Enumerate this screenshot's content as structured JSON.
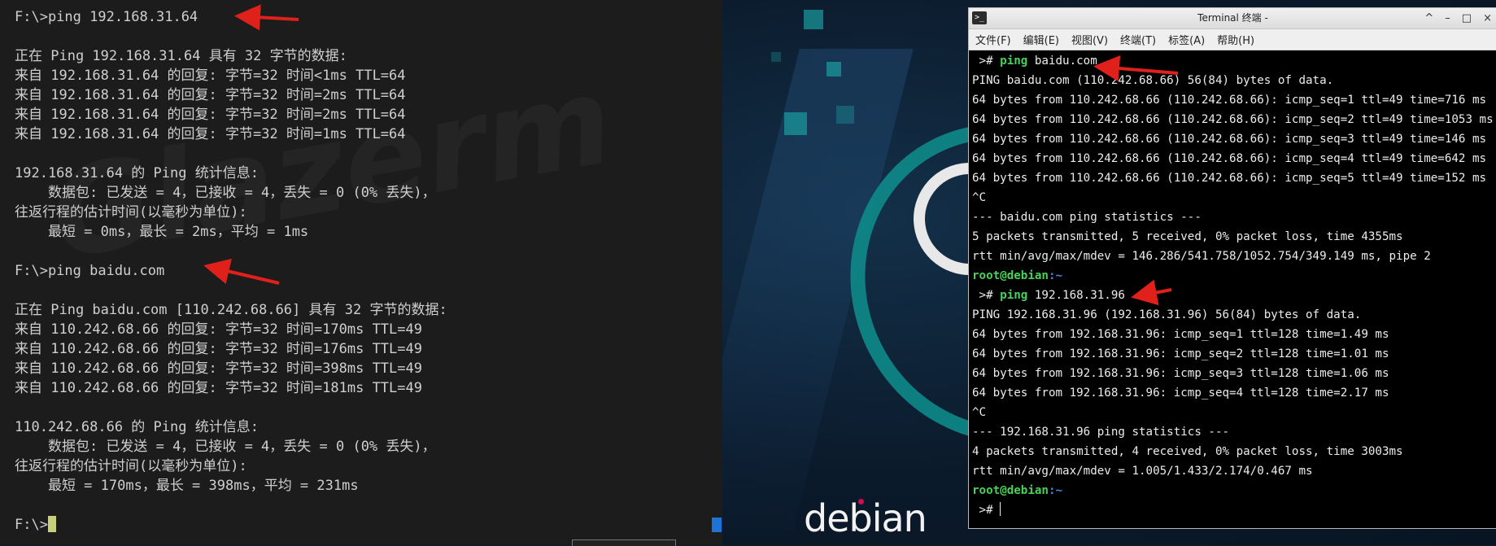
{
  "left_terminal": {
    "lines": [
      "F:\\>ping 192.168.31.64",
      "",
      "正在 Ping 192.168.31.64 具有 32 字节的数据:",
      "来自 192.168.31.64 的回复: 字节=32 时间<1ms TTL=64",
      "来自 192.168.31.64 的回复: 字节=32 时间=2ms TTL=64",
      "来自 192.168.31.64 的回复: 字节=32 时间=2ms TTL=64",
      "来自 192.168.31.64 的回复: 字节=32 时间=1ms TTL=64",
      "",
      "192.168.31.64 的 Ping 统计信息:",
      "    数据包: 已发送 = 4，已接收 = 4，丢失 = 0 (0% 丢失)，",
      "往返行程的估计时间(以毫秒为单位):",
      "    最短 = 0ms，最长 = 2ms，平均 = 1ms",
      "",
      "F:\\>ping baidu.com",
      "",
      "正在 Ping baidu.com [110.242.68.66] 具有 32 字节的数据:",
      "来自 110.242.68.66 的回复: 字节=32 时间=170ms TTL=49",
      "来自 110.242.68.66 的回复: 字节=32 时间=176ms TTL=49",
      "来自 110.242.68.66 的回复: 字节=32 时间=398ms TTL=49",
      "来自 110.242.68.66 的回复: 字节=32 时间=181ms TTL=49",
      "",
      "110.242.68.66 的 Ping 统计信息:",
      "    数据包: 已发送 = 4，已接收 = 4，丢失 = 0 (0% 丢失)，",
      "往返行程的估计时间(以毫秒为单位):",
      "    最短 = 170ms，最长 = 398ms，平均 = 231ms",
      "",
      "F:\\>"
    ]
  },
  "desktop": {
    "logo_text": "debian"
  },
  "xterm": {
    "title": "Terminal 终端 -",
    "window_buttons": [
      "^",
      "–",
      "□",
      "×"
    ],
    "menu": [
      "文件(F)",
      "编辑(E)",
      "视图(V)",
      "终端(T)",
      "标签(A)",
      "帮助(H)"
    ],
    "prompt_user": "root@debian",
    "prompt_path": ":~",
    "prompt_symbol": " >#",
    "cmd1": "ping",
    "cmd1_arg": "baidu.com",
    "block1": [
      "PING baidu.com (110.242.68.66) 56(84) bytes of data.",
      "64 bytes from 110.242.68.66 (110.242.68.66): icmp_seq=1 ttl=49 time=716 ms",
      "64 bytes from 110.242.68.66 (110.242.68.66): icmp_seq=2 ttl=49 time=1053 ms",
      "64 bytes from 110.242.68.66 (110.242.68.66): icmp_seq=3 ttl=49 time=146 ms",
      "64 bytes from 110.242.68.66 (110.242.68.66): icmp_seq=4 ttl=49 time=642 ms",
      "64 bytes from 110.242.68.66 (110.242.68.66): icmp_seq=5 ttl=49 time=152 ms",
      "^C",
      "--- baidu.com ping statistics ---",
      "5 packets transmitted, 5 received, 0% packet loss, time 4355ms",
      "rtt min/avg/max/mdev = 146.286/541.758/1052.754/349.149 ms, pipe 2"
    ],
    "cmd2": "ping",
    "cmd2_arg": "192.168.31.96",
    "block2": [
      "PING 192.168.31.96 (192.168.31.96) 56(84) bytes of data.",
      "64 bytes from 192.168.31.96: icmp_seq=1 ttl=128 time=1.49 ms",
      "64 bytes from 192.168.31.96: icmp_seq=2 ttl=128 time=1.01 ms",
      "64 bytes from 192.168.31.96: icmp_seq=3 ttl=128 time=1.06 ms",
      "64 bytes from 192.168.31.96: icmp_seq=4 ttl=128 time=2.17 ms",
      "^C",
      "--- 192.168.31.96 ping statistics ---",
      "4 packets transmitted, 4 received, 0% packet loss, time 3003ms",
      "rtt min/avg/max/mdev = 1.005/1.433/2.174/0.467 ms"
    ]
  },
  "colors": {
    "annotation_arrow": "#e0201a",
    "prompt_green": "#48d15a",
    "prompt_blue": "#4f82e0"
  }
}
